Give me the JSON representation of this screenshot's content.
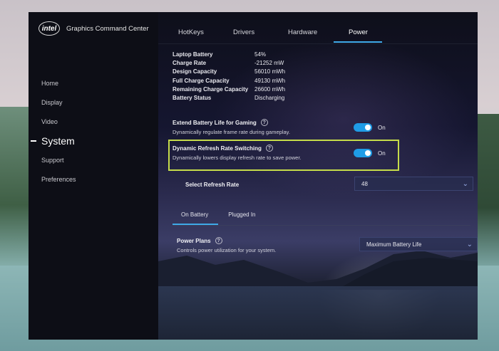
{
  "app": {
    "brand_logo_text": "intel",
    "brand_title": "Graphics Command Center"
  },
  "sidebar": {
    "items": [
      {
        "label": "Home"
      },
      {
        "label": "Display"
      },
      {
        "label": "Video"
      },
      {
        "label": "System"
      },
      {
        "label": "Support"
      },
      {
        "label": "Preferences"
      }
    ],
    "active": "System"
  },
  "tabs": [
    {
      "label": "HotKeys"
    },
    {
      "label": "Drivers"
    },
    {
      "label": "Hardware"
    },
    {
      "label": "Power"
    }
  ],
  "active_tab": "Power",
  "battery": {
    "rows": [
      {
        "label": "Laptop Battery",
        "value": "54%"
      },
      {
        "label": "Charge Rate",
        "value": "-21252 mW"
      },
      {
        "label": "Design Capacity",
        "value": "56010 mWh"
      },
      {
        "label": "Full Charge Capacity",
        "value": "49130 mWh"
      },
      {
        "label": "Remaining Charge Capacity",
        "value": "26600 mWh"
      },
      {
        "label": "Battery Status",
        "value": "Discharging"
      }
    ]
  },
  "settings": {
    "extend_battery": {
      "title": "Extend Battery Life for Gaming",
      "description": "Dynamically regulate frame rate during gameplay.",
      "state_label": "On"
    },
    "dynamic_refresh": {
      "title": "Dynamic Refresh Rate Switching",
      "description": "Dynamically lowers display refresh rate to save power.",
      "state_label": "On"
    },
    "refresh_rate": {
      "label": "Select Refresh Rate",
      "value": "48"
    }
  },
  "subtabs": [
    {
      "label": "On Battery"
    },
    {
      "label": "Plugged In"
    }
  ],
  "power_plans": {
    "title": "Power Plans",
    "description": "Controls power utilization for your system.",
    "value": "Maximum Battery Life"
  },
  "colors": {
    "accent": "#1f9ce6",
    "highlight": "#c6dc4a"
  }
}
